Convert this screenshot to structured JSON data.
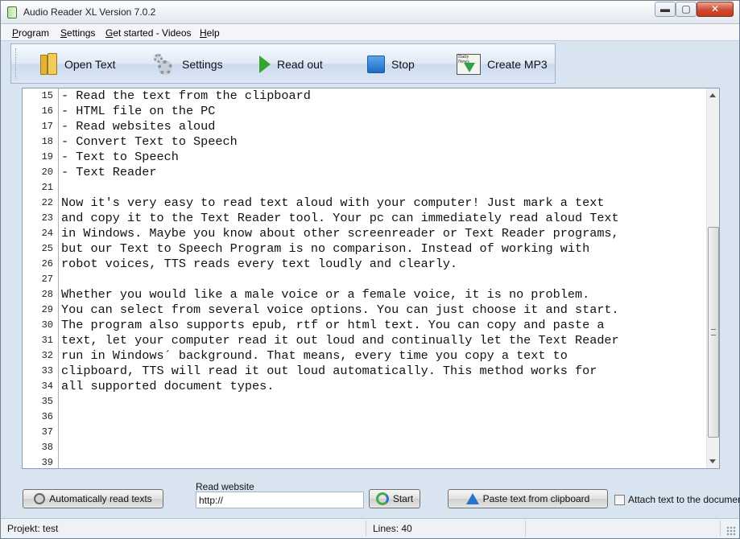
{
  "window": {
    "title": "Audio Reader XL Version 7.0.2",
    "controls": {
      "minimize": "▬",
      "maximize": "▢",
      "close": "✕"
    }
  },
  "menu": [
    "Program",
    "Settings",
    "Get started - Videos",
    "Help"
  ],
  "toolbar": {
    "open_text": "Open Text",
    "settings": "Settings",
    "read_out": "Read out",
    "stop": "Stop",
    "create_mp3": "Create MP3",
    "icons": [
      "books-icon",
      "gear-icon",
      "play-icon",
      "stop-icon",
      "newspaper-download-icon"
    ]
  },
  "editor": {
    "line_numbers": [
      "15",
      "16",
      "17",
      "18",
      "19",
      "20",
      "21",
      "22",
      "23",
      "24",
      "25",
      "26",
      "27",
      "28",
      "29",
      "30",
      "31",
      "32",
      "33",
      "34",
      "35",
      "36",
      "37",
      "38",
      "39"
    ],
    "lines": [
      "- Read the text from the clipboard",
      "- HTML file on the PC",
      "- Read websites aloud",
      "- Convert Text to Speech",
      "- Text to Speech",
      "- Text Reader",
      "",
      "Now it's very easy to read text aloud with your computer! Just mark a text",
      "and copy it to the Text Reader tool. Your pc can immediately read aloud Text",
      "in Windows. Maybe you know about other screenreader or Text Reader programs,",
      "but our Text to Speech Program is no comparison. Instead of working with",
      "robot voices, TTS reads every text loudly and clearly.",
      "",
      "Whether you would like a male voice or a female voice, it is no problem.",
      "You can select from several voice options. You can just choose it and start.",
      "The program also supports epub, rtf or html text. You can copy and paste a",
      "text, let your computer read it out loud and continually let the Text Reader",
      "run in Windows´ background. That means, every time you copy a text to",
      "clipboard, TTS will read it out loud automatically. This method works for",
      "all supported document types.",
      "",
      "",
      "",
      "",
      ""
    ]
  },
  "bottom": {
    "auto_read_button": "Automatically read texts",
    "read_website_label": "Read website",
    "website_value": "http://",
    "start_button": "Start",
    "paste_button": "Paste text from clipboard",
    "attach_label": "Attach text to the document"
  },
  "status": {
    "project": "Projekt: test",
    "lines": "Lines: 40"
  },
  "colors": {
    "window_bg": "#d9e4f1",
    "toolbar_gradient_top": "#f7fbff",
    "accent_blue": "#2873cf",
    "play_green": "#37a52d"
  }
}
